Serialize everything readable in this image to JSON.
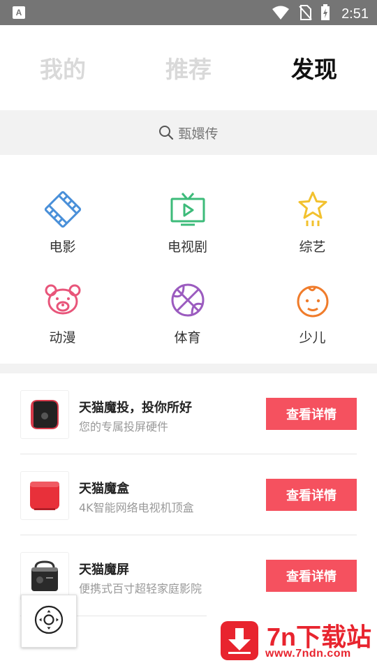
{
  "status_bar": {
    "time": "2:51",
    "app_indicator": "A",
    "icons": [
      "wifi-icon",
      "no-sim-icon",
      "battery-charging-icon"
    ]
  },
  "tabs": [
    {
      "label": "我的",
      "active": false
    },
    {
      "label": "推荐",
      "active": false
    },
    {
      "label": "发现",
      "active": true
    }
  ],
  "search": {
    "placeholder": "甄嬛传",
    "icon": "search-icon"
  },
  "categories": [
    {
      "label": "电影",
      "icon": "film-icon",
      "color": "#4a90d9"
    },
    {
      "label": "电视剧",
      "icon": "tv-icon",
      "color": "#3dbb7a"
    },
    {
      "label": "综艺",
      "icon": "star-icon",
      "color": "#f2c12e"
    },
    {
      "label": "动漫",
      "icon": "bear-icon",
      "color": "#e8557a"
    },
    {
      "label": "体育",
      "icon": "basketball-icon",
      "color": "#9b5bbf"
    },
    {
      "label": "少儿",
      "icon": "baby-face-icon",
      "color": "#f07c2b"
    }
  ],
  "products": [
    {
      "name": "天猫魔投，投你所好",
      "desc": "您的专属投屏硬件",
      "button": "查看详情",
      "icon": "projector-device-icon"
    },
    {
      "name": "天猫魔盒",
      "desc": "4K智能网络电视机顶盒",
      "button": "查看详情",
      "icon": "tv-box-device-icon"
    },
    {
      "name": "天猫魔屏",
      "desc": "便携式百寸超轻家庭影院",
      "button": "查看详情",
      "icon": "portable-projector-icon"
    }
  ],
  "colors": {
    "accent": "#f5515f",
    "watermark": "#e8242e"
  },
  "watermark": {
    "brand": "7n下载站",
    "url": "www.7ndn.com"
  }
}
